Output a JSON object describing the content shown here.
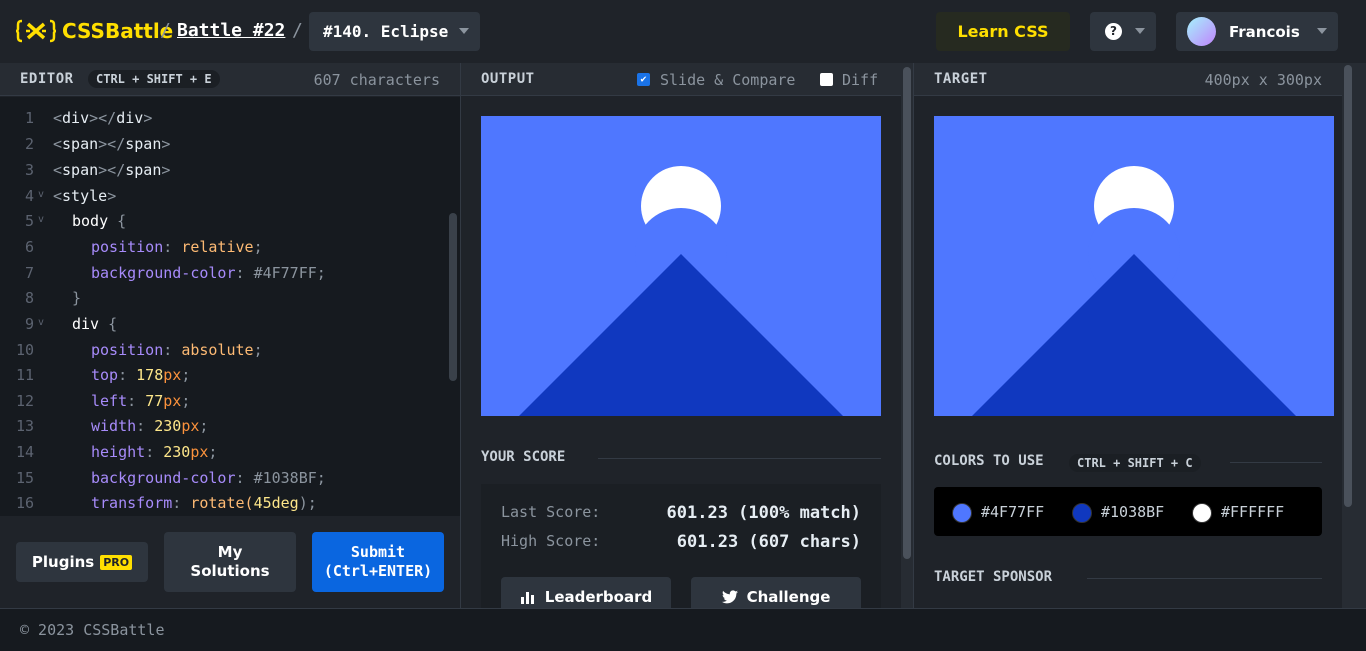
{
  "header": {
    "logo_text": "CSSBattle",
    "separator": "/",
    "battle_link": "Battle #22",
    "target_select": "#140. Eclipse",
    "learn_button": "Learn CSS",
    "help_icon": "?",
    "user_name": "Francois"
  },
  "editor": {
    "title": "EDITOR",
    "shortcut": "CTRL + SHIFT + E",
    "char_count": "607 characters",
    "lines": [
      {
        "n": "1",
        "fold": false
      },
      {
        "n": "2",
        "fold": false
      },
      {
        "n": "3",
        "fold": false
      },
      {
        "n": "4",
        "fold": true
      },
      {
        "n": "5",
        "fold": true
      },
      {
        "n": "6",
        "fold": false
      },
      {
        "n": "7",
        "fold": false
      },
      {
        "n": "8",
        "fold": false
      },
      {
        "n": "9",
        "fold": true
      },
      {
        "n": "10",
        "fold": false
      },
      {
        "n": "11",
        "fold": false
      },
      {
        "n": "12",
        "fold": false
      },
      {
        "n": "13",
        "fold": false
      },
      {
        "n": "14",
        "fold": false
      },
      {
        "n": "15",
        "fold": false
      },
      {
        "n": "16",
        "fold": false
      }
    ],
    "code": {
      "l1": [
        "<",
        "div",
        "></",
        "div",
        ">"
      ],
      "l2": [
        "<",
        "span",
        "></",
        "span",
        ">"
      ],
      "l3": [
        "<",
        "span",
        "></",
        "span",
        ">"
      ],
      "l4": [
        "<",
        "style",
        ">"
      ],
      "l5": [
        "body",
        " {"
      ],
      "l6": [
        "position",
        ": ",
        "relative",
        ";"
      ],
      "l7": [
        "background-color",
        ": ",
        "#4F77FF",
        ";"
      ],
      "l8": [
        "}"
      ],
      "l9": [
        "div",
        " {"
      ],
      "l10": [
        "position",
        ": ",
        "absolute",
        ";"
      ],
      "l11": [
        "top",
        ": ",
        "178",
        "px",
        ";"
      ],
      "l12": [
        "left",
        ": ",
        "77",
        "px",
        ";"
      ],
      "l13": [
        "width",
        ": ",
        "230",
        "px",
        ";"
      ],
      "l14": [
        "height",
        ": ",
        "230",
        "px",
        ";"
      ],
      "l15": [
        "background-color",
        ": ",
        "#1038BF",
        ";"
      ],
      "l16": [
        "transform",
        ": ",
        "rotate(",
        "45deg",
        ");"
      ]
    },
    "fold_glyph": "v",
    "plugins_button": "Plugins",
    "pro_badge": "PRO",
    "my_solutions_button": "My\nSolutions",
    "submit_button": "Submit\n(Ctrl+ENTER)"
  },
  "output": {
    "title": "OUTPUT",
    "slide_compare_label": "Slide & Compare",
    "slide_compare_checked": true,
    "diff_label": "Diff",
    "diff_checked": false,
    "check_glyph": "✔",
    "score_title": "YOUR SCORE",
    "last_score_label": "Last Score:",
    "last_score_value": "601.23 (100% match)",
    "high_score_label": "High Score:",
    "high_score_value": "601.23 (607 chars)",
    "leaderboard_button": "Leaderboard",
    "challenge_button": "Challenge"
  },
  "target": {
    "title": "TARGET",
    "dimensions": "400px x 300px",
    "colors_title": "COLORS TO USE",
    "colors_shortcut": "CTRL + SHIFT + C",
    "colors": [
      "#4F77FF",
      "#1038BF",
      "#FFFFFF"
    ],
    "sponsor_title": "TARGET SPONSOR"
  },
  "theme": {
    "background": "#4F77FF",
    "mountain": "#1038BF",
    "moon": "#FFFFFF",
    "accent_yellow": "#FFDF00",
    "submit_blue": "#0A66E0"
  },
  "footer": {
    "copyright": "© 2023 CSSBattle"
  }
}
